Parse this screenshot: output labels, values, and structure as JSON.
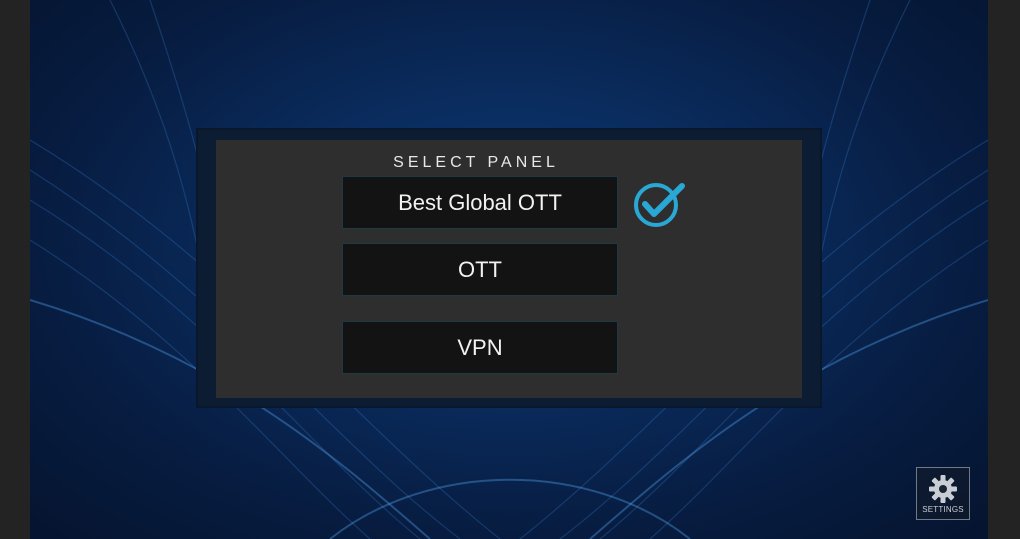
{
  "panel": {
    "title": "SELECT PANEL",
    "options": [
      {
        "label": "Best Global OTT",
        "selected": true
      },
      {
        "label": "OTT",
        "selected": false
      },
      {
        "label": "VPN",
        "selected": false
      }
    ]
  },
  "settings": {
    "label": "SETTINGS",
    "icon": "gear-icon"
  },
  "colors": {
    "background": "#0a2c5e",
    "panel": "#2e2e2e",
    "button": "#131313",
    "check": "#29a8d6"
  },
  "icons": {
    "selected": "check-circle-icon"
  }
}
